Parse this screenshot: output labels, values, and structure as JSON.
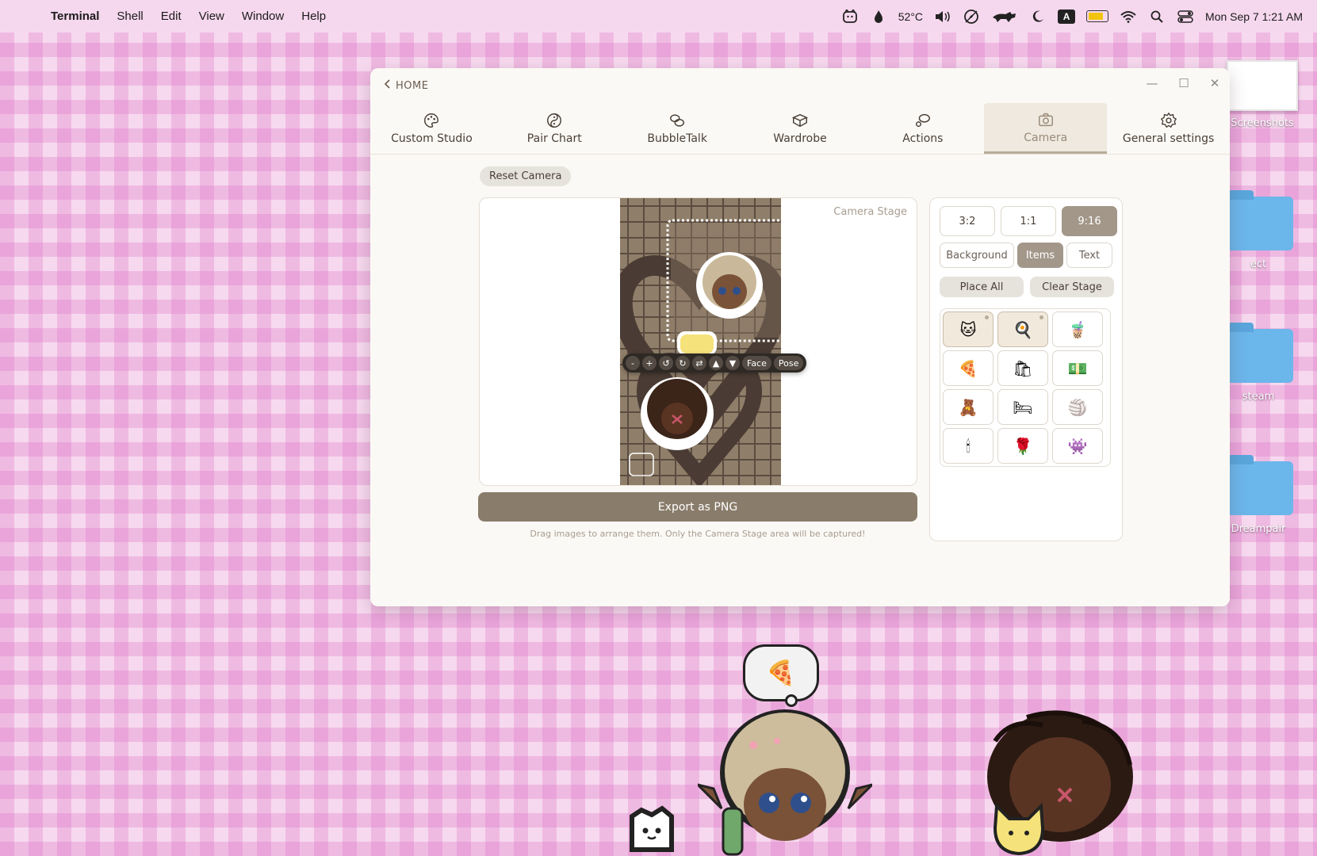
{
  "menubar": {
    "apple": "",
    "app": "Terminal",
    "items": [
      "Shell",
      "Edit",
      "View",
      "Window",
      "Help"
    ],
    "temperature": "52°C",
    "input_source": "A",
    "clock": "Mon Sep 7  1:21 AM"
  },
  "window": {
    "home_label": "HOME",
    "controls": {
      "minimize": "—",
      "maximize": "☐",
      "close": "✕"
    },
    "tabs": [
      {
        "label": "Custom Studio",
        "icon": "palette-icon",
        "active": false
      },
      {
        "label": "Pair Chart",
        "icon": "yin-yang-icon",
        "active": false
      },
      {
        "label": "BubbleTalk",
        "icon": "chat-bubbles-icon",
        "active": false
      },
      {
        "label": "Wardrobe",
        "icon": "hanger-icon",
        "active": false
      },
      {
        "label": "Actions",
        "icon": "speech-icon",
        "active": false
      },
      {
        "label": "Camera",
        "icon": "camera-icon",
        "active": true
      },
      {
        "label": "General settings",
        "icon": "gear-icon",
        "active": false
      }
    ],
    "reset_camera": "Reset Camera",
    "stage_label": "Camera Stage",
    "toolbar": {
      "buttons": [
        "-",
        "+",
        "↺",
        "↻",
        "⇄",
        "▲",
        "▼"
      ],
      "face": "Face",
      "pose": "Pose"
    },
    "export_label": "Export as PNG",
    "hint": "Drag images to arrange them. Only the Camera Stage area will be captured!",
    "ratios": [
      {
        "label": "3:2",
        "active": false
      },
      {
        "label": "1:1",
        "active": false
      },
      {
        "label": "9:16",
        "active": true
      }
    ],
    "segments": [
      {
        "label": "Background",
        "active": false
      },
      {
        "label": "Items",
        "active": true
      },
      {
        "label": "Text",
        "active": false
      }
    ],
    "place_all": "Place All",
    "clear_stage": "Clear Stage",
    "items": [
      {
        "icon": "cat-icon",
        "glyph": "🐱",
        "selected": true
      },
      {
        "icon": "egg-icon",
        "glyph": "🍳",
        "selected": true
      },
      {
        "icon": "drink-icon",
        "glyph": "🧋",
        "selected": false
      },
      {
        "icon": "pizza-icon",
        "glyph": "🍕",
        "selected": false
      },
      {
        "icon": "trash-bag-icon",
        "glyph": "🛍",
        "selected": false
      },
      {
        "icon": "money-icon",
        "glyph": "💵",
        "selected": false
      },
      {
        "icon": "cookie-bear-icon",
        "glyph": "🧸",
        "selected": false
      },
      {
        "icon": "bed-icon",
        "glyph": "🛏",
        "selected": false
      },
      {
        "icon": "ball-icon",
        "glyph": "🏐",
        "selected": false
      },
      {
        "icon": "lamp-icon",
        "glyph": "🕯",
        "selected": false
      },
      {
        "icon": "rose-icon",
        "glyph": "🌹",
        "selected": false
      },
      {
        "icon": "ghost-icon",
        "glyph": "👾",
        "selected": false
      }
    ]
  },
  "desktop": {
    "items": [
      {
        "label": "Screenshots",
        "type": "thumbnail"
      },
      {
        "label": "ect",
        "type": "folder"
      },
      {
        "label": "steam",
        "type": "folder"
      },
      {
        "label": "Dreampair",
        "type": "folder"
      }
    ],
    "bubble_glyph": "🍕",
    "watermark": "dreampair"
  },
  "colors": {
    "accent": "#a3978a",
    "export": "#8a7c6b",
    "desktop_pink": "#f7d9ef"
  }
}
